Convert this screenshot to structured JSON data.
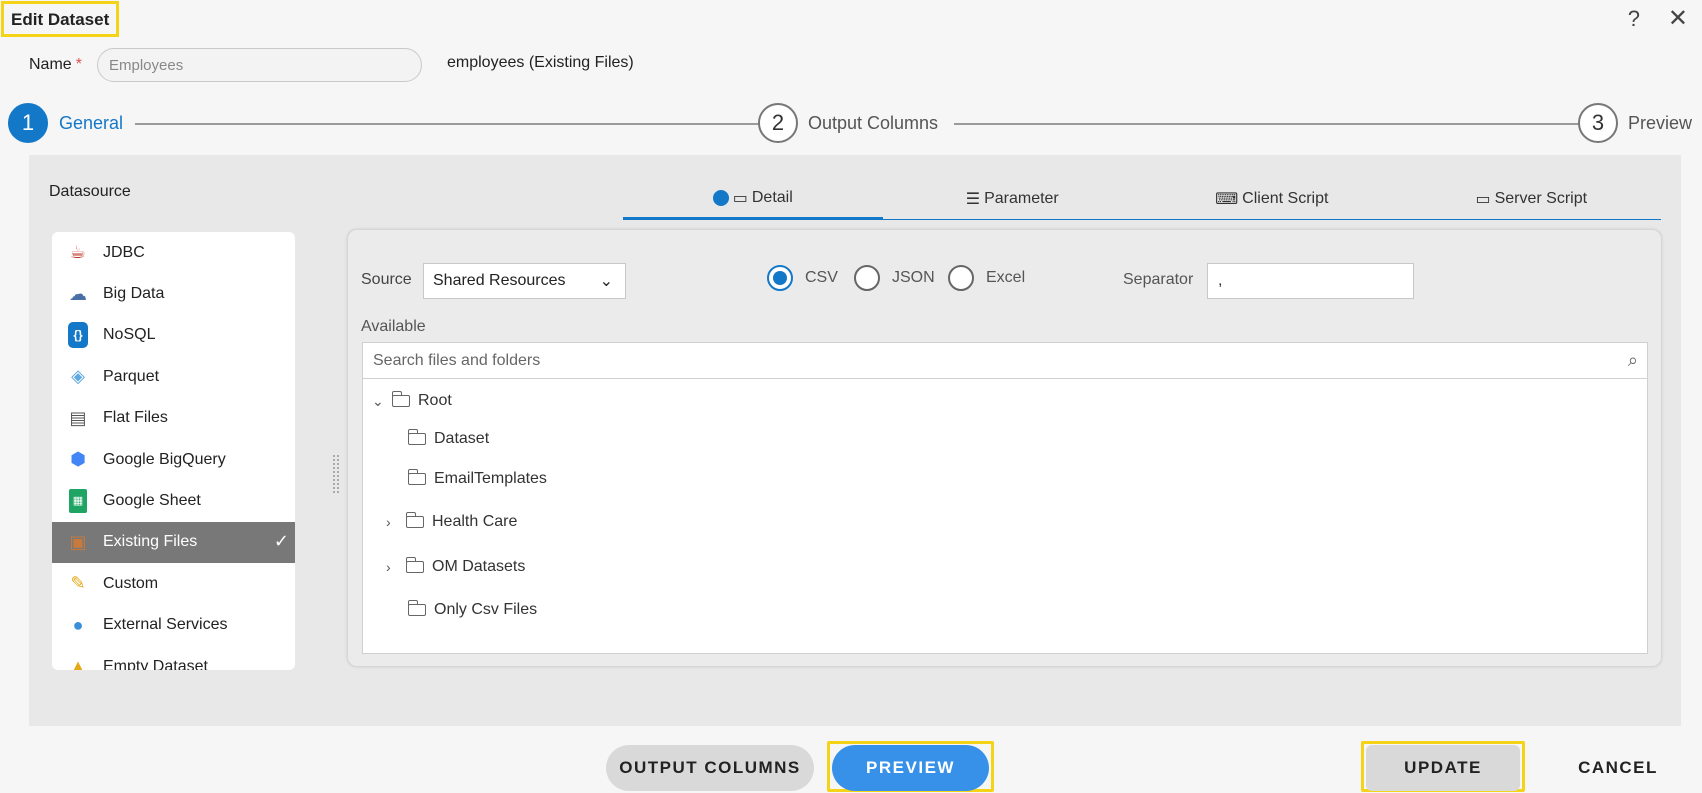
{
  "dialog": {
    "title": "Edit Dataset",
    "help_glyph": "?",
    "close_glyph": "✕"
  },
  "name_field": {
    "label": "Name",
    "required_mark": "*",
    "value": "Employees",
    "source_text": "employees (Existing Files)"
  },
  "stepper": [
    {
      "number": "1",
      "label": "General",
      "state": "active"
    },
    {
      "number": "2",
      "label": "Output Columns",
      "state": "inactive"
    },
    {
      "number": "3",
      "label": "Preview",
      "state": "inactive"
    }
  ],
  "datasource": {
    "heading": "Datasource",
    "items": [
      {
        "label": "JDBC",
        "icon": "java-icon",
        "selected": false
      },
      {
        "label": "Big Data",
        "icon": "cloud-database-icon",
        "selected": false
      },
      {
        "label": "NoSQL",
        "icon": "nosql-icon",
        "selected": false
      },
      {
        "label": "Parquet",
        "icon": "parquet-icon",
        "selected": false
      },
      {
        "label": "Flat Files",
        "icon": "flat-file-icon",
        "selected": false
      },
      {
        "label": "Google BigQuery",
        "icon": "bigquery-icon",
        "selected": false
      },
      {
        "label": "Google Sheet",
        "icon": "google-sheet-icon",
        "selected": false
      },
      {
        "label": "Existing Files",
        "icon": "existing-files-icon",
        "selected": true
      },
      {
        "label": "Custom",
        "icon": "custom-tools-icon",
        "selected": false
      },
      {
        "label": "External Services",
        "icon": "globe-icon",
        "selected": false
      },
      {
        "label": "Empty Dataset",
        "icon": "empty-dataset-icon",
        "selected": false
      }
    ]
  },
  "tabs": [
    {
      "label": "Detail",
      "icon": "detail-icon",
      "active": true
    },
    {
      "label": "Parameter",
      "icon": "sliders-icon",
      "active": false
    },
    {
      "label": "Client Script",
      "icon": "client-script-icon",
      "active": false
    },
    {
      "label": "Server Script",
      "icon": "server-script-icon",
      "active": false
    }
  ],
  "detail": {
    "source_label": "Source",
    "source_value": "Shared Resources",
    "formats": [
      {
        "label": "CSV",
        "checked": true
      },
      {
        "label": "JSON",
        "checked": false
      },
      {
        "label": "Excel",
        "checked": false
      }
    ],
    "separator_label": "Separator",
    "separator_value": ",",
    "available_label": "Available",
    "search_placeholder": "Search files and folders",
    "tree": [
      {
        "label": "Root",
        "caret": "expanded",
        "indent": 0
      },
      {
        "label": "Dataset",
        "caret": "none",
        "indent": 1
      },
      {
        "label": "EmailTemplates",
        "caret": "none",
        "indent": 1
      },
      {
        "label": "Health Care",
        "caret": "collapsed",
        "indent": 1
      },
      {
        "label": "OM Datasets",
        "caret": "collapsed",
        "indent": 1
      },
      {
        "label": "Only Csv Files",
        "caret": "none",
        "indent": 1
      }
    ]
  },
  "footer": {
    "output_columns_label": "OUTPUT COLUMNS",
    "preview_label": "PREVIEW",
    "update_label": "UPDATE",
    "cancel_label": "CANCEL"
  },
  "colors": {
    "accent": "#1478c8",
    "highlight": "#f5d418",
    "selected_row": "#787878",
    "preview_button": "#3891e8"
  }
}
